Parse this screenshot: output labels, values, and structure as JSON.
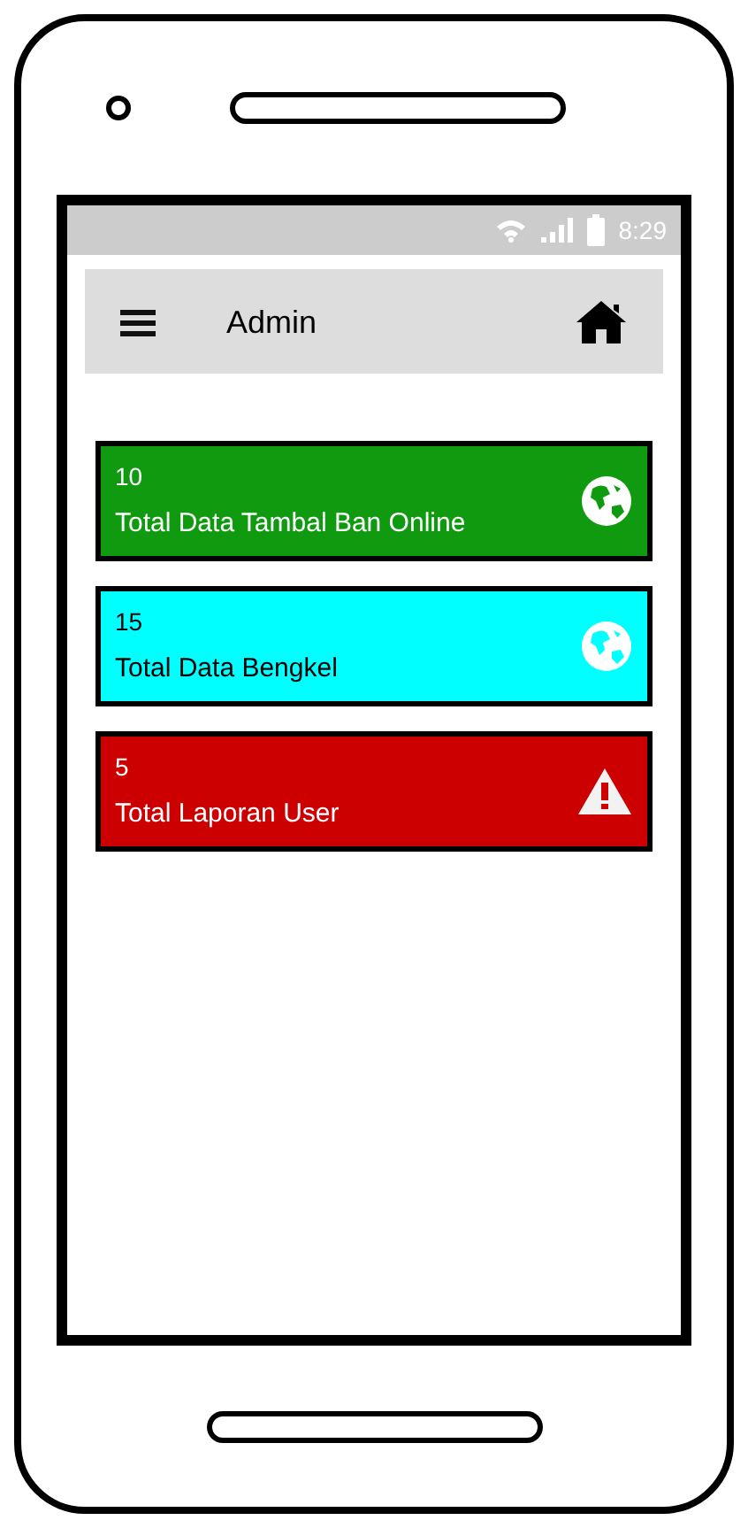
{
  "status_bar": {
    "time": "8:29"
  },
  "app_bar": {
    "title": "Admin"
  },
  "cards": [
    {
      "count": "10",
      "label": "Total Data Tambal Ban Online",
      "color": "#109a10",
      "kind": "globe"
    },
    {
      "count": "15",
      "label": "Total Data Bengkel",
      "color": "#00ffff",
      "kind": "globe"
    },
    {
      "count": "5",
      "label": "Total Laporan User",
      "color": "#cc0000",
      "kind": "warning"
    }
  ]
}
